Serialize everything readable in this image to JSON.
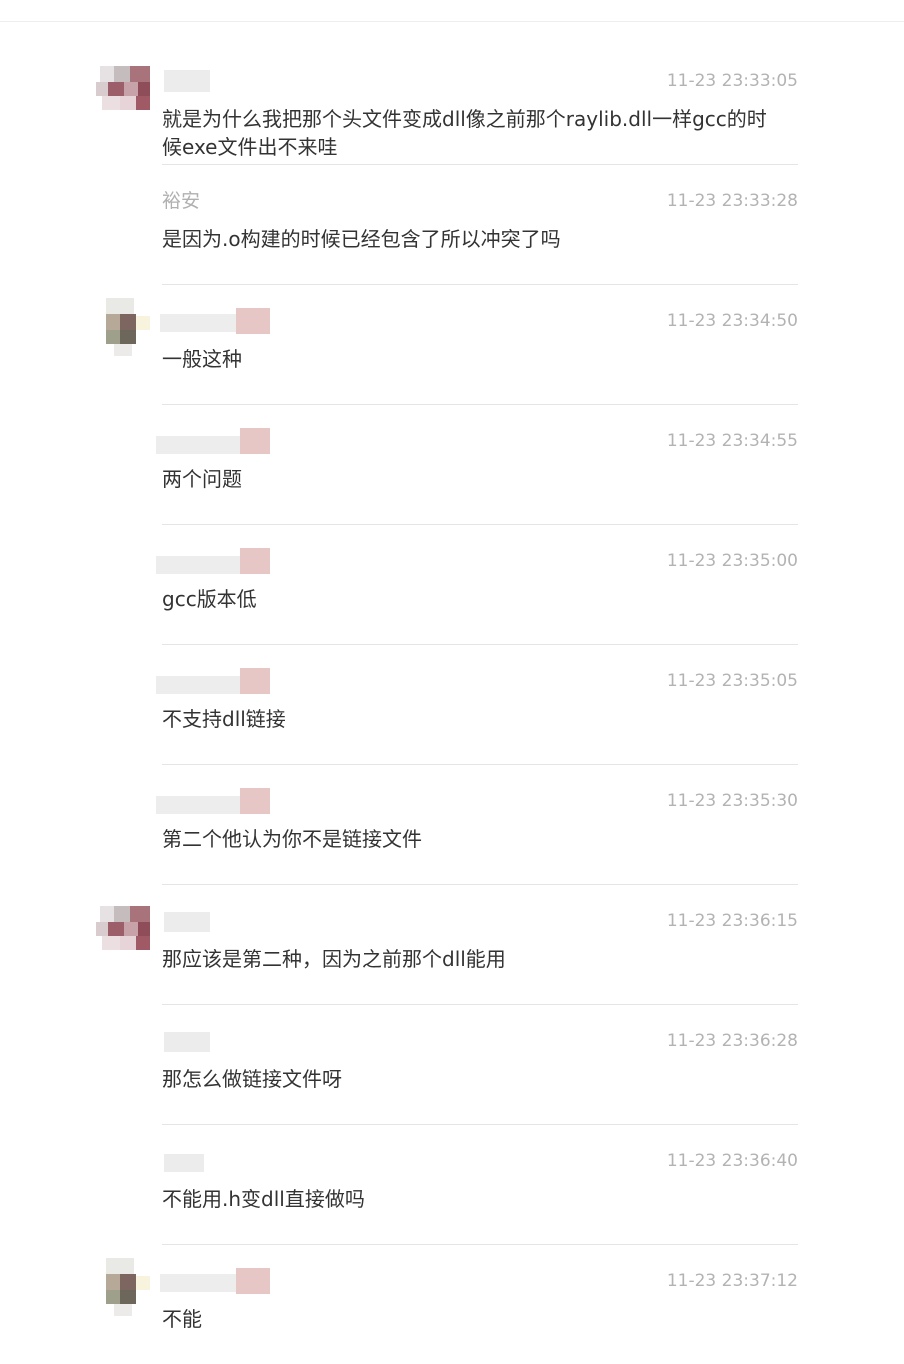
{
  "messages": [
    {
      "sender": "",
      "time": "11-23 23:33:05",
      "text": "就是为什么我把那个头文件变成dll像之前那个raylib.dll一样gcc的时候exe文件出不来哇"
    },
    {
      "sender": "裕安",
      "time": "11-23 23:33:28",
      "text": "是因为.o构建的时候已经包含了所以冲突了吗"
    },
    {
      "sender": "",
      "time": "11-23 23:34:50",
      "text": "一般这种"
    },
    {
      "sender": "",
      "time": "11-23 23:34:55",
      "text": "两个问题"
    },
    {
      "sender": "",
      "time": "11-23 23:35:00",
      "text": "gcc版本低"
    },
    {
      "sender": "",
      "time": "11-23 23:35:05",
      "text": "不支持dll链接"
    },
    {
      "sender": "",
      "time": "11-23 23:35:30",
      "text": "第二个他认为你不是链接文件"
    },
    {
      "sender": "",
      "time": "11-23 23:36:15",
      "text": "那应该是第二种，因为之前那个dll能用"
    },
    {
      "sender": "",
      "time": "11-23 23:36:28",
      "text": "那怎么做链接文件呀"
    },
    {
      "sender": "",
      "time": "11-23 23:36:40",
      "text": "不能用.h变dll直接做吗"
    },
    {
      "sender": "",
      "time": "11-23 23:37:12",
      "text": "不能"
    }
  ]
}
